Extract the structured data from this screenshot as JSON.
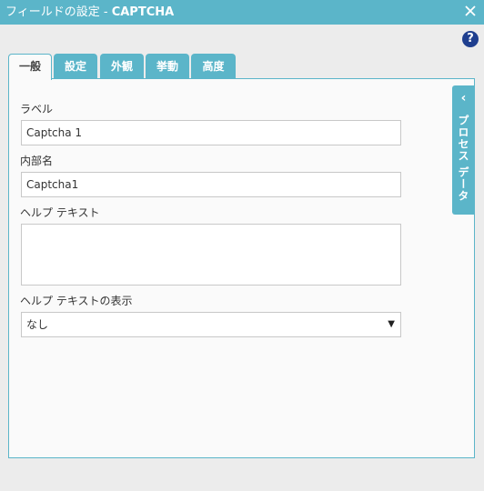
{
  "window": {
    "title_prefix": "フィールドの設定 - ",
    "title_bold": "CAPTCHA"
  },
  "tabs": [
    {
      "label": "一般"
    },
    {
      "label": "設定"
    },
    {
      "label": "外観"
    },
    {
      "label": "挙動"
    },
    {
      "label": "高度"
    }
  ],
  "help": {
    "glyph": "?"
  },
  "side_panel": {
    "label": "プロセス データ",
    "chevron": "‹"
  },
  "form": {
    "label_caption": "ラベル",
    "label_value": "Captcha 1",
    "internal_name_caption": "内部名",
    "internal_name_value": "Captcha1",
    "help_text_caption": "ヘルプ テキスト",
    "help_text_value": "",
    "help_display_caption": "ヘルプ テキストの表示",
    "help_display_value": "なし"
  },
  "colors": {
    "accent": "#5bb5c9",
    "help_icon": "#1f3f8f"
  }
}
